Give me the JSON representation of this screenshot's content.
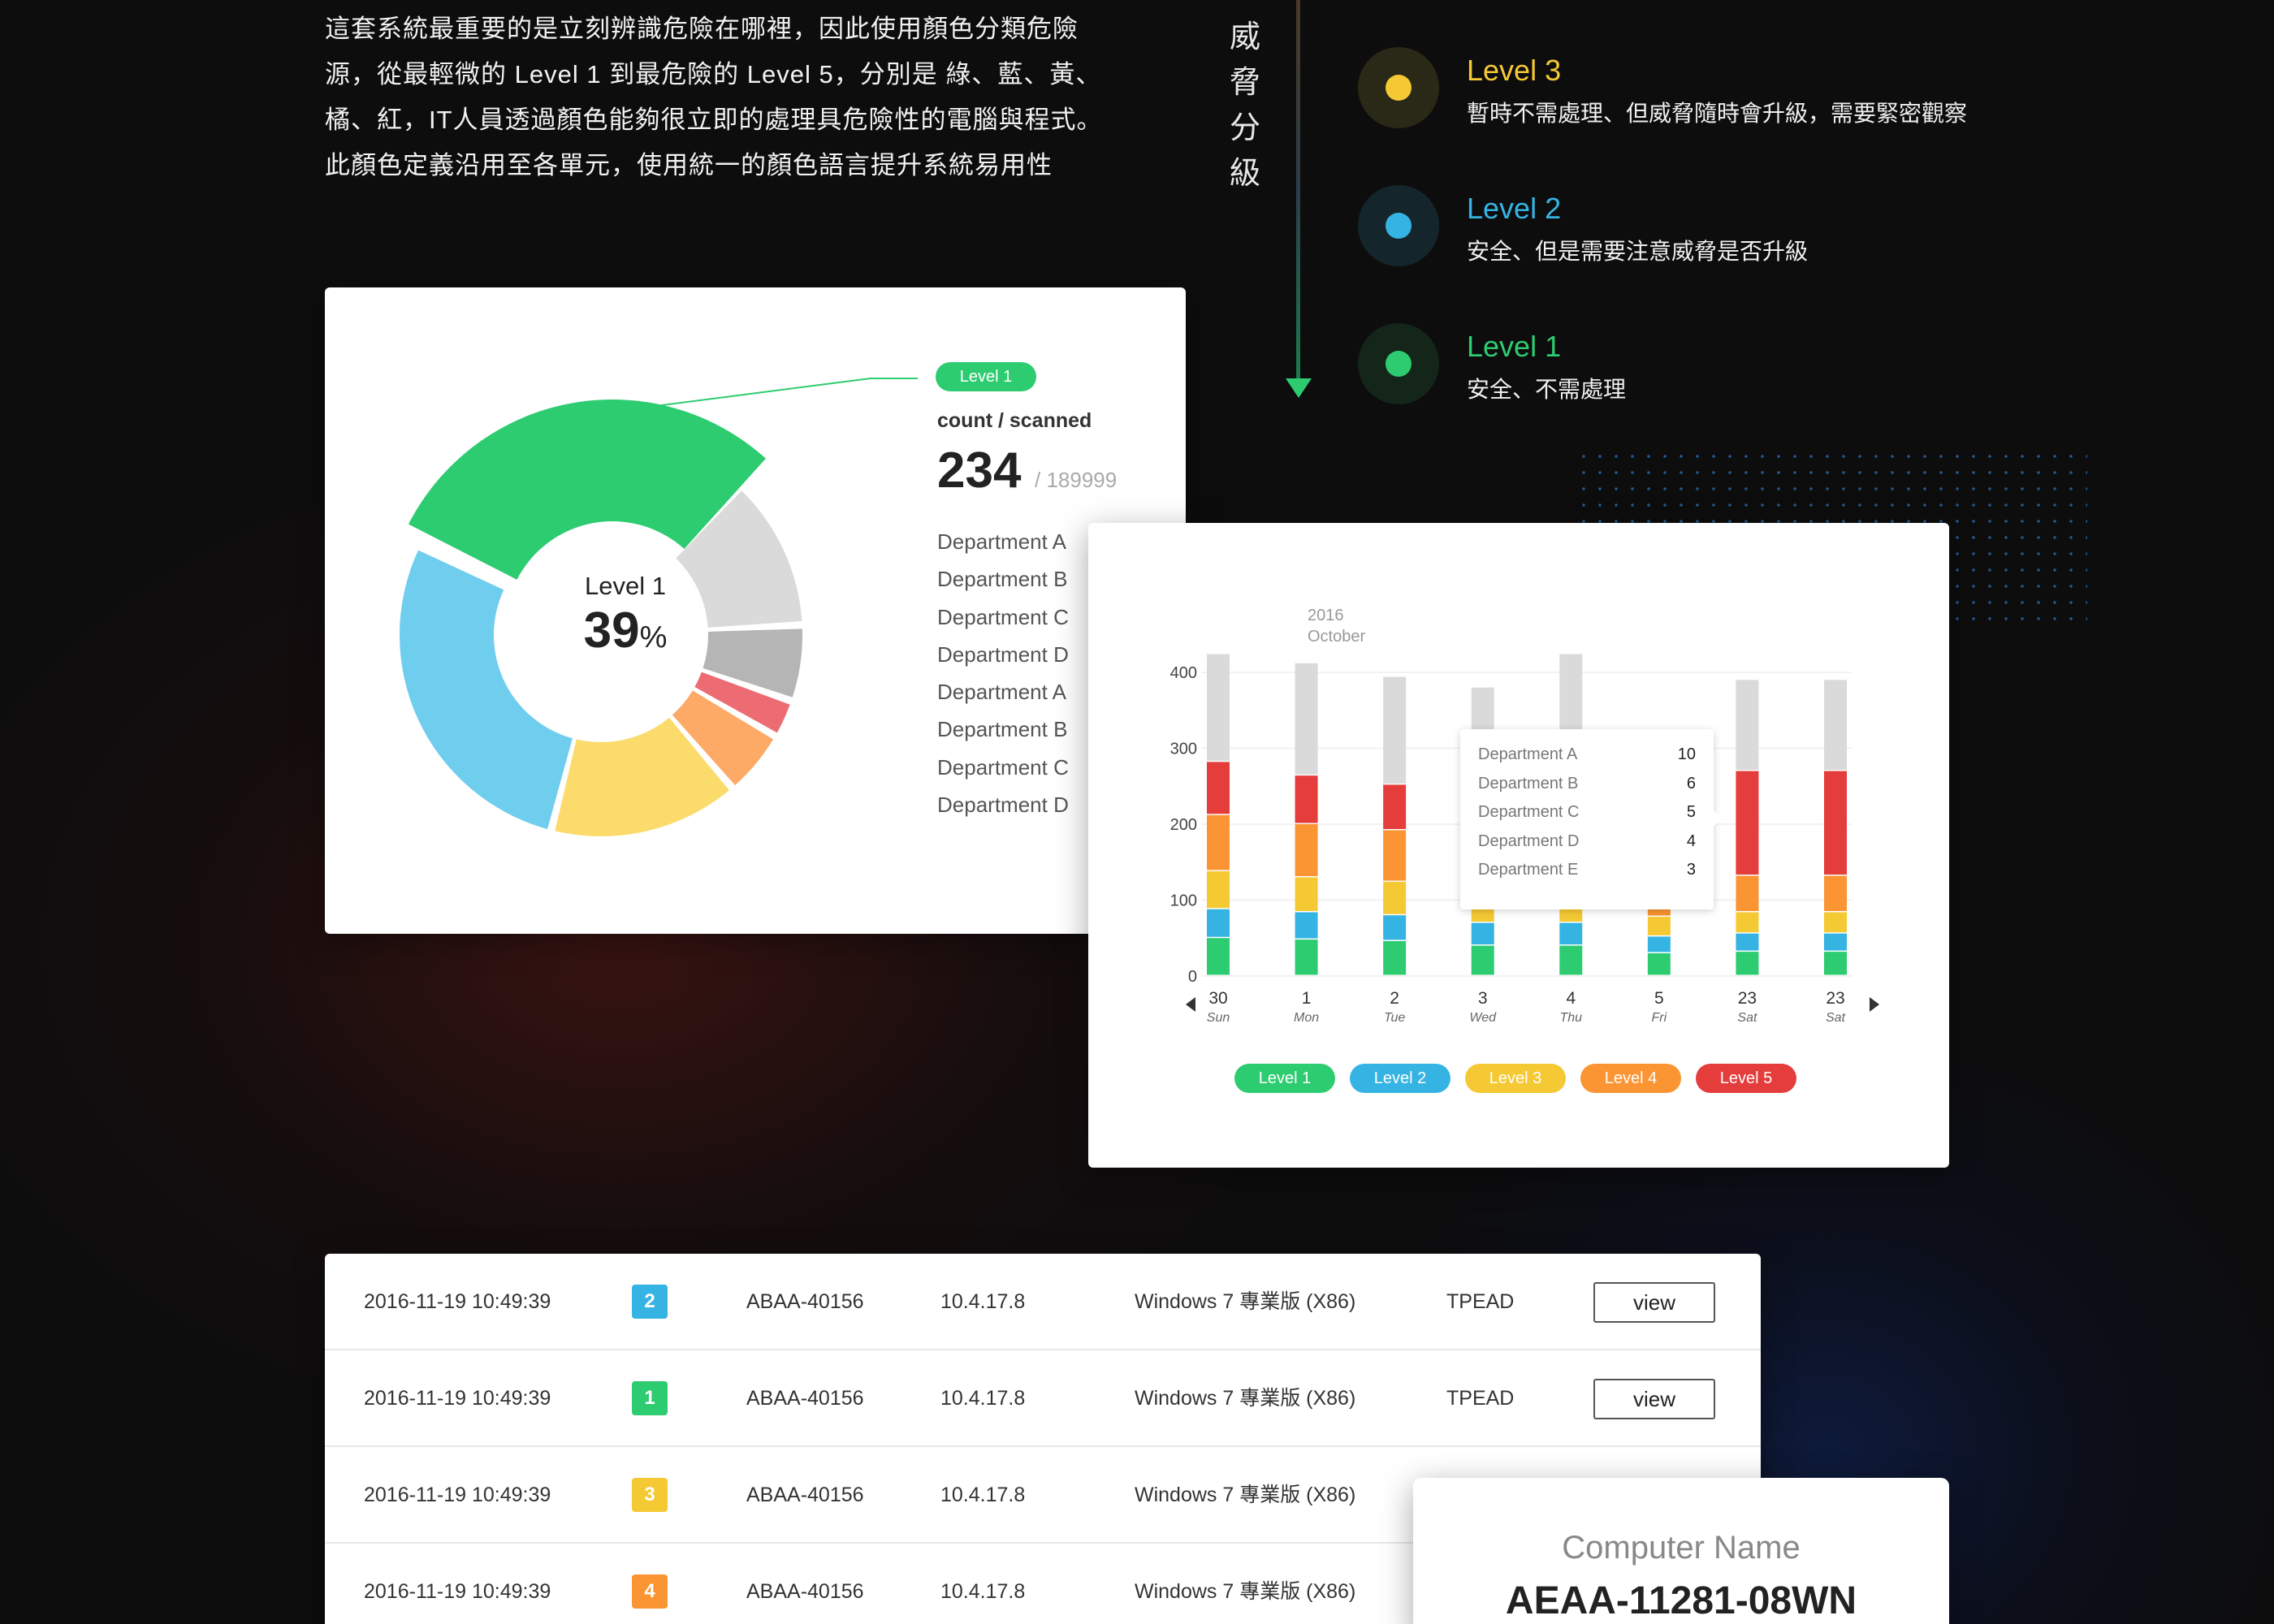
{
  "intro": {
    "lines": [
      "這套系統最重要的是立刻辨識危險在哪裡，因此使用顏色分類危險",
      "源，從最輕微的 Level 1 到最危險的 Level 5，分別是 綠、藍、黃、",
      "橘、紅，IT人員透過顏色能夠很立即的處理具危險性的電腦與程式。",
      "此顏色定義沿用至各單元，使用統一的顏色語言提升系統易用性"
    ]
  },
  "threat_title": [
    "威",
    "脅",
    "分",
    "級"
  ],
  "levels": [
    {
      "title": "Level 3",
      "desc": "暫時不需處理、但威脅隨時會升級，需要緊密觀察",
      "color": "#f5c933",
      "halo": "#2a2817"
    },
    {
      "title": "Level 2",
      "desc": "安全、但是需要注意威脅是否升級",
      "color": "#35b4e3",
      "halo": "#14262c"
    },
    {
      "title": "Level 1",
      "desc": "安全、不需處理",
      "color": "#2ecc71",
      "halo": "#142519"
    }
  ],
  "donut": {
    "pill": "Level 1",
    "center_level": "Level 1",
    "center_value": "39",
    "center_unit": "%",
    "count_label": "count / scanned",
    "count": "234",
    "scanned": "/ 189999",
    "departments": [
      "Department A",
      "Department B",
      "Department C",
      "Department D",
      "Department A",
      "Department B",
      "Department C",
      "Department D"
    ]
  },
  "colors": {
    "level1": "#2ecc71",
    "level2": "#35b4e3",
    "level3": "#f5c933",
    "level4": "#fb9432",
    "level5": "#e53c3c",
    "unscanned": "#dadada"
  },
  "chart_data": {
    "type": "bar",
    "stacked": true,
    "annotation": "2016 October",
    "annotation_year": "2016",
    "annotation_month": "October",
    "ylim": [
      0,
      400
    ],
    "yticks": [
      0,
      100,
      200,
      300,
      400
    ],
    "categories": [
      "30",
      "1",
      "2",
      "3",
      "4",
      "5",
      "23",
      "23"
    ],
    "category_days": [
      "Sun",
      "Mon",
      "Tue",
      "Wed",
      "Thu",
      "Fri",
      "Sat",
      "Sat"
    ],
    "series": [
      {
        "name": "Level 1",
        "values": [
          50,
          48,
          46,
          40,
          40,
          30,
          32,
          32
        ]
      },
      {
        "name": "Level 2",
        "values": [
          38,
          36,
          34,
          30,
          30,
          22,
          24,
          24
        ]
      },
      {
        "name": "Level 3",
        "values": [
          50,
          46,
          44,
          30,
          30,
          26,
          28,
          28
        ]
      },
      {
        "name": "Level 4",
        "values": [
          74,
          70,
          68,
          60,
          64,
          40,
          48,
          48
        ]
      },
      {
        "name": "Level 5",
        "values": [
          70,
          64,
          60,
          60,
          60,
          40,
          138,
          138
        ]
      },
      {
        "values": [
          142,
          148,
          142,
          160,
          200,
          20,
          120,
          120
        ]
      }
    ],
    "legend": [
      "Level 1",
      "Level 2",
      "Level 3",
      "Level 4",
      "Level 5"
    ],
    "legend_placement": "bottom",
    "grid": true,
    "tooltip": [
      {
        "k": "Department A",
        "v": "10"
      },
      {
        "k": "Department B",
        "v": "6"
      },
      {
        "k": "Department C",
        "v": "5"
      },
      {
        "k": "Department D",
        "v": "4"
      },
      {
        "k": "Department E",
        "v": "3"
      }
    ]
  },
  "donut_chart_data": {
    "type": "pie",
    "slices": [
      {
        "value": 39,
        "color": "#2ecc71",
        "highlight": true
      },
      {
        "value": 16,
        "color": "#dadada"
      },
      {
        "value": 8,
        "color": "#b5b5b5"
      },
      {
        "value": 4,
        "color": "#ed6b72"
      },
      {
        "value": 7,
        "color": "#fdaa66"
      },
      {
        "value": 20,
        "color": "#fbdb6b"
      },
      {
        "value": 37,
        "color": "#6fcdee"
      }
    ]
  },
  "table": {
    "rows": [
      {
        "time": "2016-11-19 10:49:39",
        "level": "2",
        "color": "#35b4e3",
        "id": "ABAA-40156",
        "ver": "10.4.17.8",
        "os": "Windows 7 專業版 (X86)",
        "dept": "TPEAD",
        "action": "view"
      },
      {
        "time": "2016-11-19 10:49:39",
        "level": "1",
        "color": "#2ecc71",
        "id": "ABAA-40156",
        "ver": "10.4.17.8",
        "os": "Windows 7 專業版 (X86)",
        "dept": "TPEAD",
        "action": "view"
      },
      {
        "time": "2016-11-19 10:49:39",
        "level": "3",
        "color": "#f5c933",
        "id": "ABAA-40156",
        "ver": "10.4.17.8",
        "os": "Windows 7 專業版 (X86)",
        "dept": "",
        "action": ""
      },
      {
        "time": "2016-11-19 10:49:39",
        "level": "4",
        "color": "#fb9432",
        "id": "ABAA-40156",
        "ver": "10.4.17.8",
        "os": "Windows 7 專業版 (X86)",
        "dept": "",
        "action": ""
      }
    ]
  },
  "computer": {
    "label": "Computer Name",
    "value": "AEAA-11281-08WN"
  }
}
